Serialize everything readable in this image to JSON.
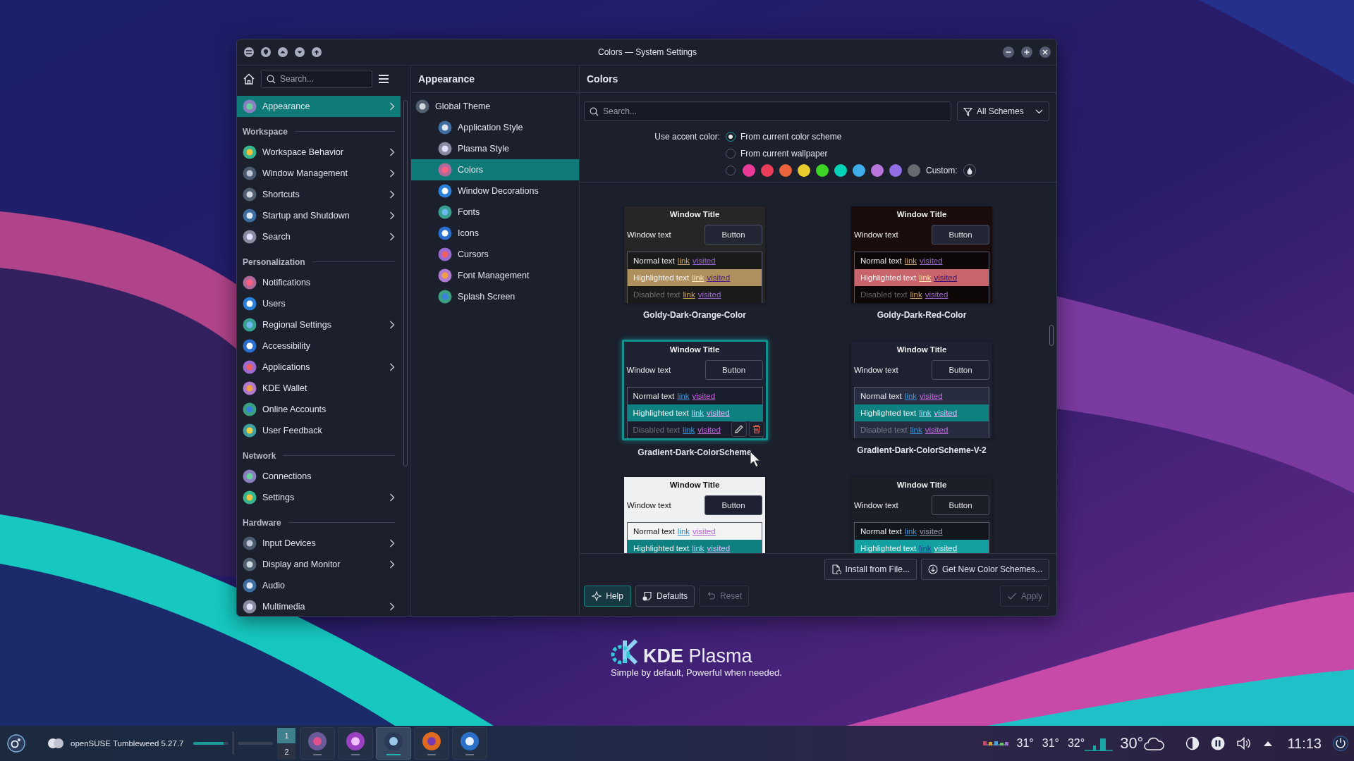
{
  "window": {
    "title": "Colors — System Settings"
  },
  "sidebar": {
    "search": {
      "placeholder": "Search..."
    },
    "items": [
      {
        "kind": "item",
        "label": "Appearance",
        "arrow": true,
        "selected": true
      },
      {
        "kind": "heading",
        "label": "Workspace"
      },
      {
        "kind": "item",
        "label": "Workspace Behavior",
        "arrow": true,
        "selected": false
      },
      {
        "kind": "item",
        "label": "Window Management",
        "arrow": true,
        "selected": false
      },
      {
        "kind": "item",
        "label": "Shortcuts",
        "arrow": true,
        "selected": false
      },
      {
        "kind": "item",
        "label": "Startup and Shutdown",
        "arrow": true,
        "selected": false
      },
      {
        "kind": "item",
        "label": "Search",
        "arrow": true,
        "selected": false
      },
      {
        "kind": "heading",
        "label": "Personalization"
      },
      {
        "kind": "item",
        "label": "Notifications",
        "arrow": false,
        "selected": false
      },
      {
        "kind": "item",
        "label": "Users",
        "arrow": false,
        "selected": false
      },
      {
        "kind": "item",
        "label": "Regional Settings",
        "arrow": true,
        "selected": false
      },
      {
        "kind": "item",
        "label": "Accessibility",
        "arrow": false,
        "selected": false
      },
      {
        "kind": "item",
        "label": "Applications",
        "arrow": true,
        "selected": false
      },
      {
        "kind": "item",
        "label": "KDE Wallet",
        "arrow": false,
        "selected": false
      },
      {
        "kind": "item",
        "label": "Online Accounts",
        "arrow": false,
        "selected": false
      },
      {
        "kind": "item",
        "label": "User Feedback",
        "arrow": false,
        "selected": false
      },
      {
        "kind": "heading",
        "label": "Network"
      },
      {
        "kind": "item",
        "label": "Connections",
        "arrow": false,
        "selected": false
      },
      {
        "kind": "item",
        "label": "Settings",
        "arrow": true,
        "selected": false
      },
      {
        "kind": "heading",
        "label": "Hardware"
      },
      {
        "kind": "item",
        "label": "Input Devices",
        "arrow": true,
        "selected": false
      },
      {
        "kind": "item",
        "label": "Display and Monitor",
        "arrow": true,
        "selected": false
      },
      {
        "kind": "item",
        "label": "Audio",
        "arrow": false,
        "selected": false
      },
      {
        "kind": "item",
        "label": "Multimedia",
        "arrow": true,
        "selected": false
      }
    ]
  },
  "category": {
    "title": "Appearance",
    "items": [
      {
        "label": "Global Theme",
        "selected": false,
        "children": [
          {
            "label": "Application Style",
            "selected": false
          },
          {
            "label": "Plasma Style",
            "selected": false
          },
          {
            "label": "Colors",
            "selected": true
          },
          {
            "label": "Window Decorations",
            "selected": false
          },
          {
            "label": "Fonts",
            "selected": false
          },
          {
            "label": "Icons",
            "selected": false
          },
          {
            "label": "Cursors",
            "selected": false
          },
          {
            "label": "Font Management",
            "selected": false
          },
          {
            "label": "Splash Screen",
            "selected": false
          }
        ]
      }
    ]
  },
  "colors_page": {
    "title": "Colors",
    "search": {
      "placeholder": "Search..."
    },
    "filter": "All Schemes",
    "accent": {
      "label": "Use accent color:",
      "options": [
        {
          "kind": "scheme",
          "label": "From current color scheme",
          "selected": true
        },
        {
          "kind": "wallpaper",
          "label": "From current wallpaper",
          "selected": false
        },
        {
          "kind": "custom",
          "selected": false,
          "label": "Custom:",
          "swatches": [
            {
              "color": "#e93a9a"
            },
            {
              "color": "#e93d58"
            },
            {
              "color": "#e9643a"
            },
            {
              "color": "#e8cb2d"
            },
            {
              "color": "#3dd425"
            },
            {
              "color": "#00d3b8"
            },
            {
              "color": "#3daee9"
            },
            {
              "color": "#b875dc"
            },
            {
              "color": "#926ee4"
            },
            {
              "color": "#686b6f"
            }
          ]
        }
      ]
    },
    "schemes": [
      {
        "name": "Goldy-Dark-Orange-Color",
        "selected": false,
        "hovered": false,
        "color": "#b08f5e",
        "title": "Window Title",
        "window_text": "Window text",
        "button": "Button",
        "rows": [
          {
            "kind": "normal",
            "text": "Normal text",
            "link": "link",
            "visited": "visited"
          },
          {
            "kind": "highlighted",
            "text": "Highlighted text",
            "link": "link",
            "visited": "visited"
          },
          {
            "kind": "disabled",
            "text": "Disabled text",
            "link": "link",
            "visited": "visited"
          }
        ]
      },
      {
        "name": "Goldy-Dark-Red-Color",
        "selected": false,
        "hovered": false,
        "color": "#c8646c",
        "title": "Window Title",
        "window_text": "Window text",
        "button": "Button",
        "rows": [
          {
            "kind": "normal",
            "text": "Normal text",
            "link": "link",
            "visited": "visited"
          },
          {
            "kind": "highlighted",
            "text": "Highlighted text",
            "link": "link",
            "visited": "visited"
          },
          {
            "kind": "disabled",
            "text": "Disabled text",
            "link": "link",
            "visited": "visited"
          }
        ]
      },
      {
        "name": "Gradient-Dark-ColorScheme",
        "selected": true,
        "hovered": true,
        "color": "#0f8080",
        "title": "Window Title",
        "window_text": "Window text",
        "button": "Button",
        "rows": [
          {
            "kind": "normal",
            "text": "Normal text",
            "link": "link",
            "visited": "visited"
          },
          {
            "kind": "highlighted",
            "text": "Highlighted text",
            "link": "link",
            "visited": "visited"
          },
          {
            "kind": "disabled",
            "text": "Disabled text",
            "link": "link",
            "visited": "visited"
          }
        ]
      },
      {
        "name": "Gradient-Dark-ColorScheme-V-2",
        "selected": false,
        "hovered": false,
        "color": "#0f8080",
        "title": "Window Title",
        "window_text": "Window text",
        "button": "Button",
        "rows": [
          {
            "kind": "normal",
            "text": "Normal text",
            "link": "link",
            "visited": "visited"
          },
          {
            "kind": "highlighted",
            "text": "Highlighted text",
            "link": "link",
            "visited": "visited"
          },
          {
            "kind": "disabled",
            "text": "Disabled text",
            "link": "link",
            "visited": "visited"
          }
        ]
      },
      {
        "selected": false,
        "hovered": false,
        "color": "#0f8080",
        "title": "Window Title",
        "window_text": "Window text",
        "button": "Button",
        "rows": [
          {
            "kind": "normal",
            "text": "Normal text",
            "link": "link",
            "visited": "visited"
          },
          {
            "kind": "highlighted",
            "text": "Highlighted text",
            "link": "link",
            "visited": "visited"
          }
        ]
      },
      {
        "selected": false,
        "hovered": false,
        "color": "#13a0a0",
        "title": "Window Title",
        "window_text": "Window text",
        "button": "Button",
        "rows": [
          {
            "kind": "normal",
            "text": "Normal text",
            "link": "link",
            "visited": "visited"
          },
          {
            "kind": "highlighted",
            "text": "Highlighted text",
            "link": "link",
            "visited": "visited"
          }
        ]
      }
    ],
    "actions": [
      {
        "kind": "install",
        "label": "Install from File..."
      },
      {
        "kind": "download",
        "label": "Get New Color Schemes..."
      }
    ],
    "buttons": [
      {
        "kind": "help",
        "label": "Help",
        "disabled": false,
        "focused": true
      },
      {
        "kind": "defaults",
        "label": "Defaults",
        "disabled": false,
        "focused": false
      },
      {
        "kind": "reset",
        "label": "Reset",
        "disabled": true,
        "focused": false
      },
      {
        "kind": "apply",
        "label": "Apply",
        "disabled": true,
        "focused": false
      }
    ]
  },
  "desktop": {
    "logo": "**KDE** Plasma",
    "tagline": "Simple by default, Powerful when needed."
  },
  "taskbar": {
    "activity": "openSUSE Tumbleweed 5.27.7",
    "meters": [
      {
        "level": 0.85
      },
      {
        "level": 0
      }
    ],
    "desktops": [
      {
        "label": "1",
        "selected": true
      },
      {
        "label": "2",
        "selected": false
      }
    ],
    "tasks": [
      {
        "selected": false
      },
      {
        "selected": false
      },
      {
        "selected": true
      },
      {
        "selected": false
      },
      {
        "selected": false
      }
    ],
    "temperatures": [
      "31°",
      "31°",
      "32°"
    ],
    "weather": "30°",
    "clock": "11:13"
  }
}
